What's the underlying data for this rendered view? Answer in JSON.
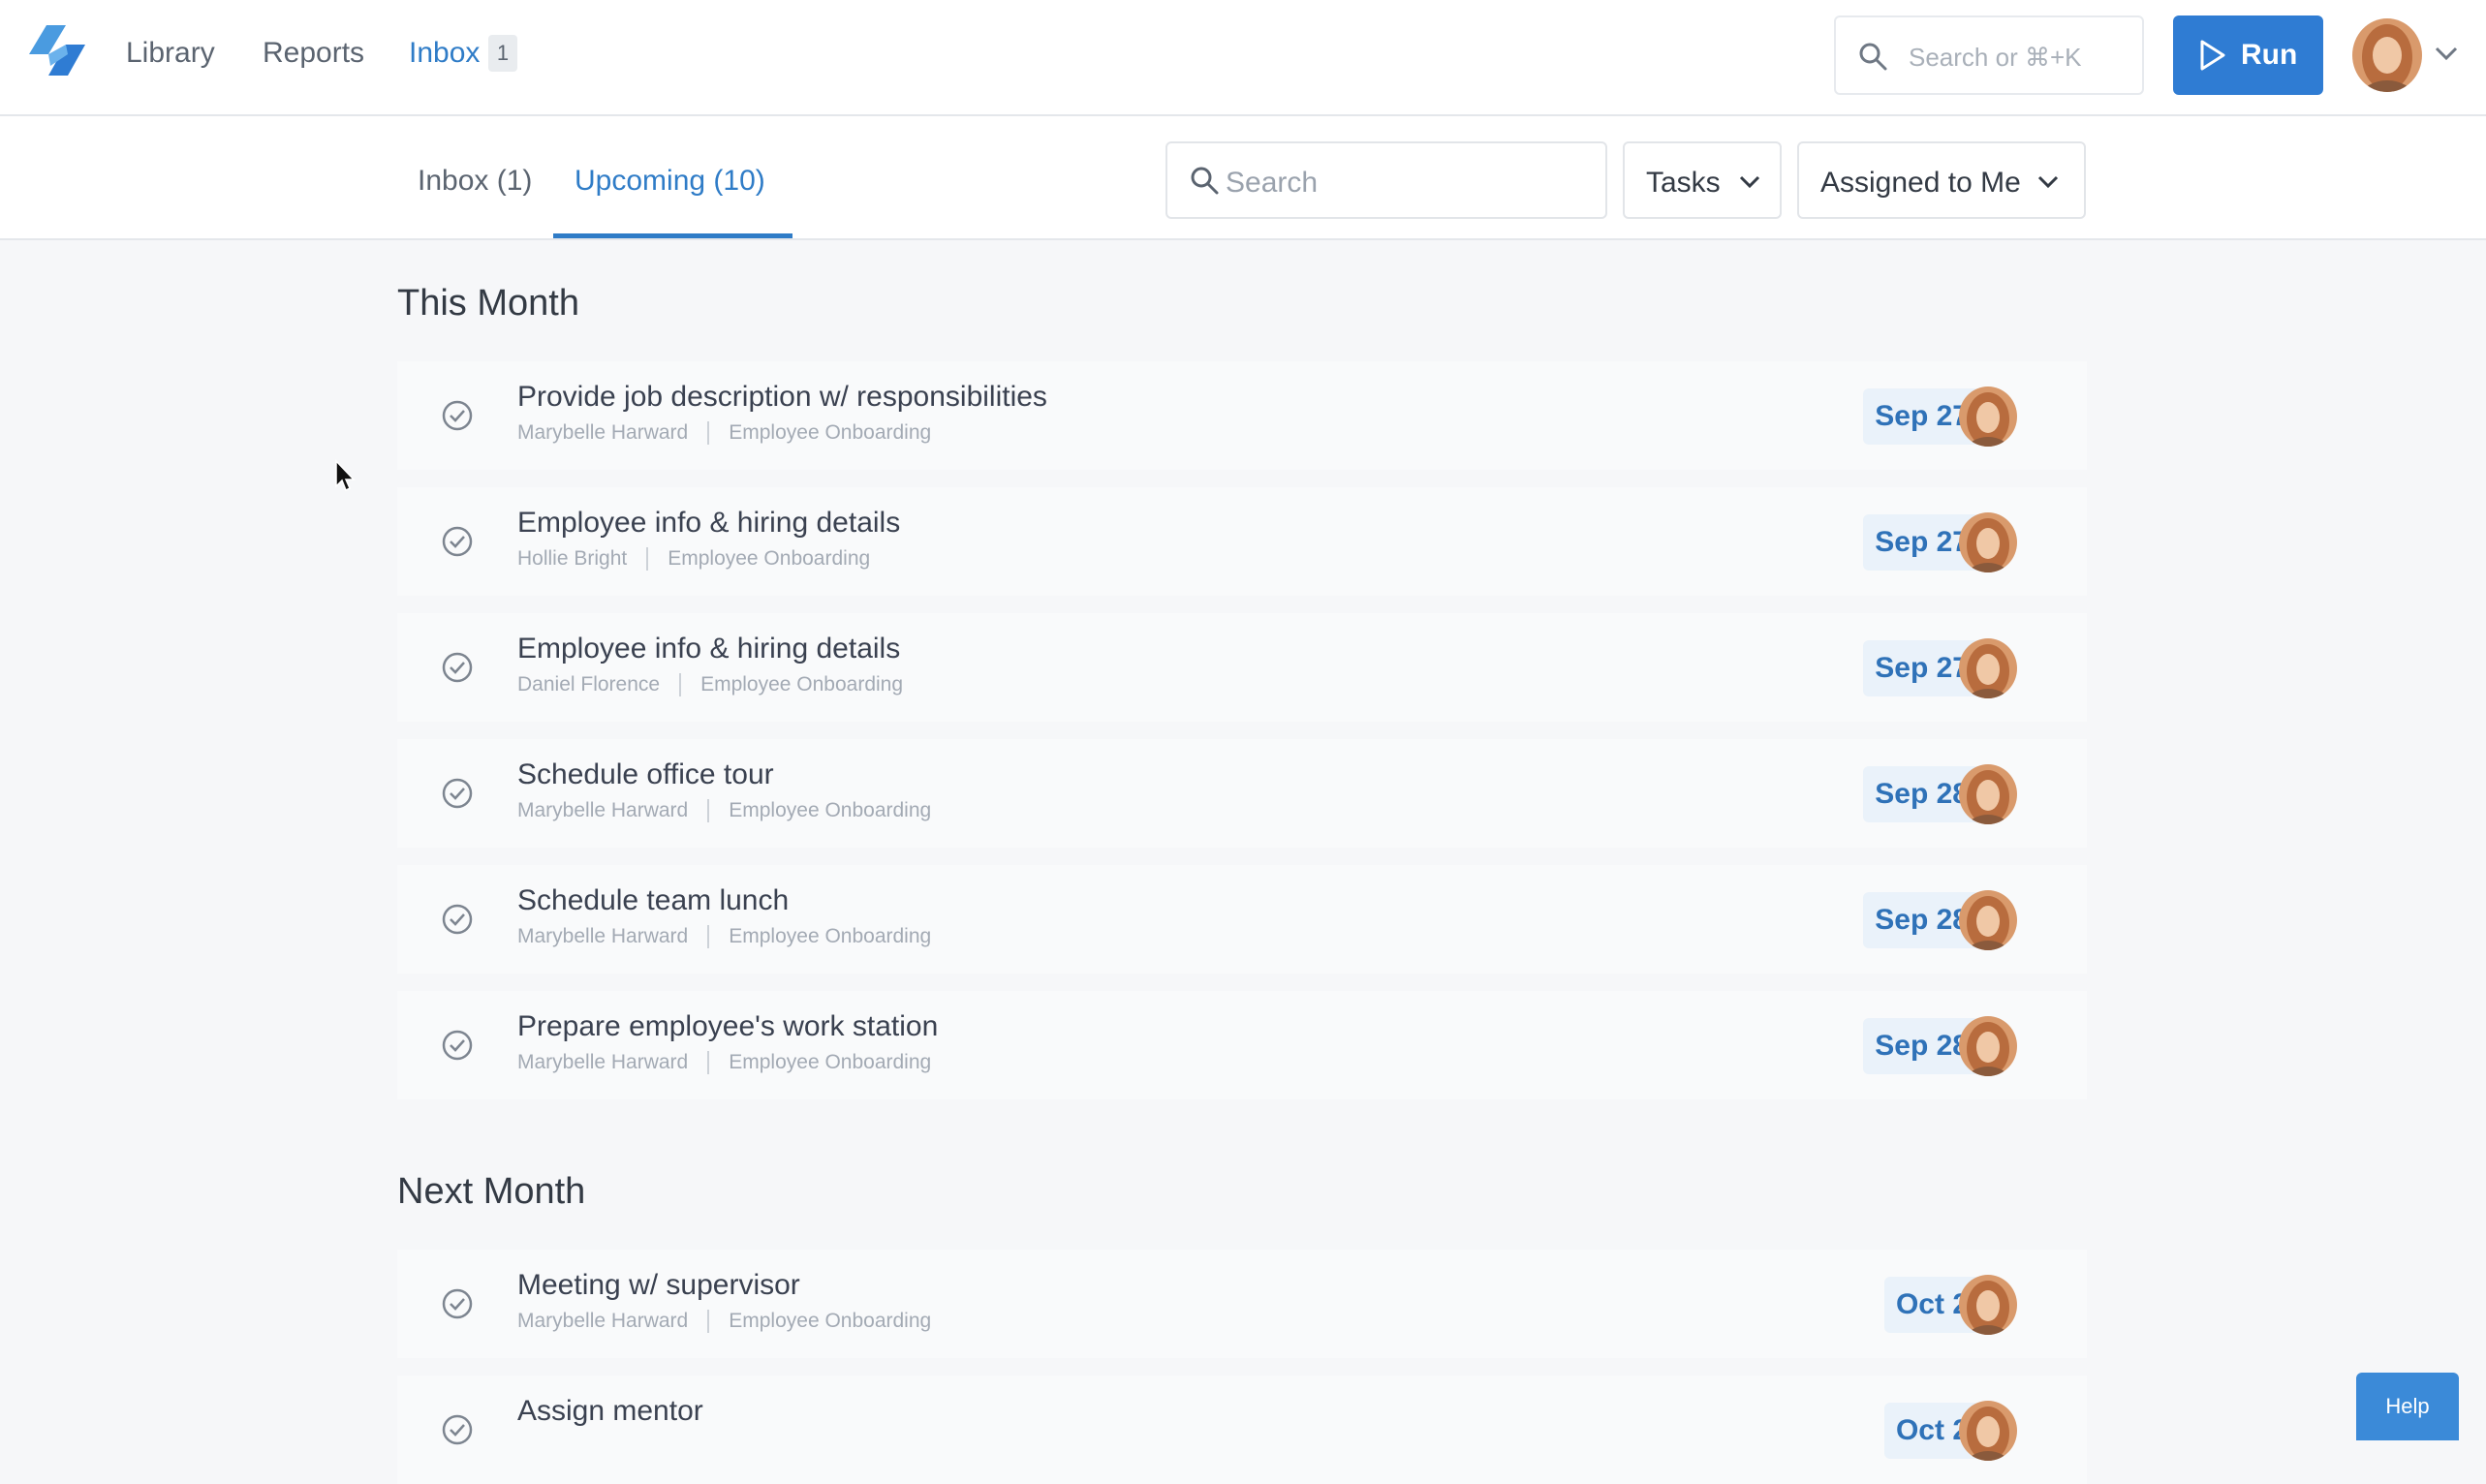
{
  "nav": {
    "library": "Library",
    "reports": "Reports",
    "inbox": "Inbox",
    "inbox_badge": "1",
    "search_placeholder": "Search or ⌘+K",
    "run_label": "Run"
  },
  "tabs": {
    "inbox": "Inbox (1)",
    "upcoming": "Upcoming (10)",
    "active": "upcoming"
  },
  "filters": {
    "search_placeholder": "Search",
    "type_value": "Tasks",
    "assignee_value": "Assigned to Me"
  },
  "sections": [
    {
      "title": "This Month",
      "tasks": [
        {
          "title": "Provide job description w/ responsibilities",
          "person": "Marybelle Harward",
          "workflow": "Employee Onboarding",
          "date": "Sep 27"
        },
        {
          "title": "Employee info & hiring details",
          "person": "Hollie Bright",
          "workflow": "Employee Onboarding",
          "date": "Sep 27"
        },
        {
          "title": "Employee info & hiring details",
          "person": "Daniel Florence",
          "workflow": "Employee Onboarding",
          "date": "Sep 27"
        },
        {
          "title": "Schedule office tour",
          "person": "Marybelle Harward",
          "workflow": "Employee Onboarding",
          "date": "Sep 28"
        },
        {
          "title": "Schedule team lunch",
          "person": "Marybelle Harward",
          "workflow": "Employee Onboarding",
          "date": "Sep 28"
        },
        {
          "title": "Prepare employee's work station",
          "person": "Marybelle Harward",
          "workflow": "Employee Onboarding",
          "date": "Sep 28"
        }
      ]
    },
    {
      "title": "Next Month",
      "tasks": [
        {
          "title": "Meeting w/ supervisor",
          "person": "Marybelle Harward",
          "workflow": "Employee Onboarding",
          "date": "Oct 2"
        },
        {
          "title": "Assign mentor",
          "person": "",
          "workflow": "",
          "date": "Oct 2"
        }
      ]
    }
  ],
  "help_label": "Help",
  "colors": {
    "accent": "#2f7cc7",
    "run_button": "#2f7cd3",
    "date_badge_bg": "#eaf2fa",
    "date_badge_text": "#2f72b8"
  },
  "icons": [
    "logo-icon",
    "search-icon",
    "play-icon",
    "chevron-down-icon",
    "check-circle-icon",
    "cursor-icon"
  ]
}
